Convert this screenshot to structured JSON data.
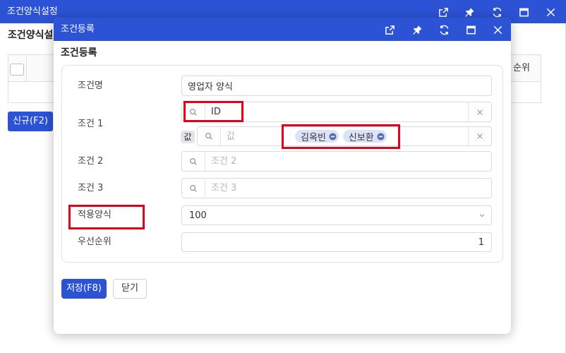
{
  "colors": {
    "title_bar": "#2c52d5",
    "primary_button": "#2c52d5",
    "highlight_box": "#e2001a",
    "tag_background": "#dbe3f8",
    "tag_remove_icon": "#5870b3"
  },
  "background_window": {
    "title": "조건양식설정",
    "window_controls": [
      "external-link-icon",
      "pin-icon",
      "refresh-icon",
      "maximize-icon",
      "close-icon"
    ],
    "heading": "조건양식설",
    "table": {
      "select_all_checked": false,
      "columns": [
        "순위"
      ]
    },
    "new_button": "신규(F2)"
  },
  "dialog": {
    "title": "조건등록",
    "window_controls": [
      "external-link-icon",
      "pin-icon",
      "refresh-icon",
      "maximize-icon",
      "close-icon"
    ],
    "heading": "조건등록",
    "form": {
      "condition_name": {
        "label": "조건명",
        "value": "영업자 양식"
      },
      "condition_1": {
        "label": "조건 1",
        "field": {
          "value": "ID",
          "search_icon": "search-icon",
          "clear_icon": "close-icon"
        },
        "value_field": {
          "badge": "값",
          "placeholder": "값",
          "tags": [
            "김옥빈",
            "신보환"
          ],
          "tag_remove_icon": "minus-circle-icon",
          "clear_icon": "close-icon"
        }
      },
      "condition_2": {
        "label": "조건 2",
        "placeholder": "조건 2"
      },
      "condition_3": {
        "label": "조건 3",
        "placeholder": "조건 3"
      },
      "apply_format": {
        "label": "적용양식",
        "selected": "100",
        "dropdown_icon": "chevron-down-icon"
      },
      "priority": {
        "label": "우선순위",
        "value": "1"
      }
    },
    "buttons": {
      "save": "저장(F8)",
      "close": "닫기"
    }
  }
}
